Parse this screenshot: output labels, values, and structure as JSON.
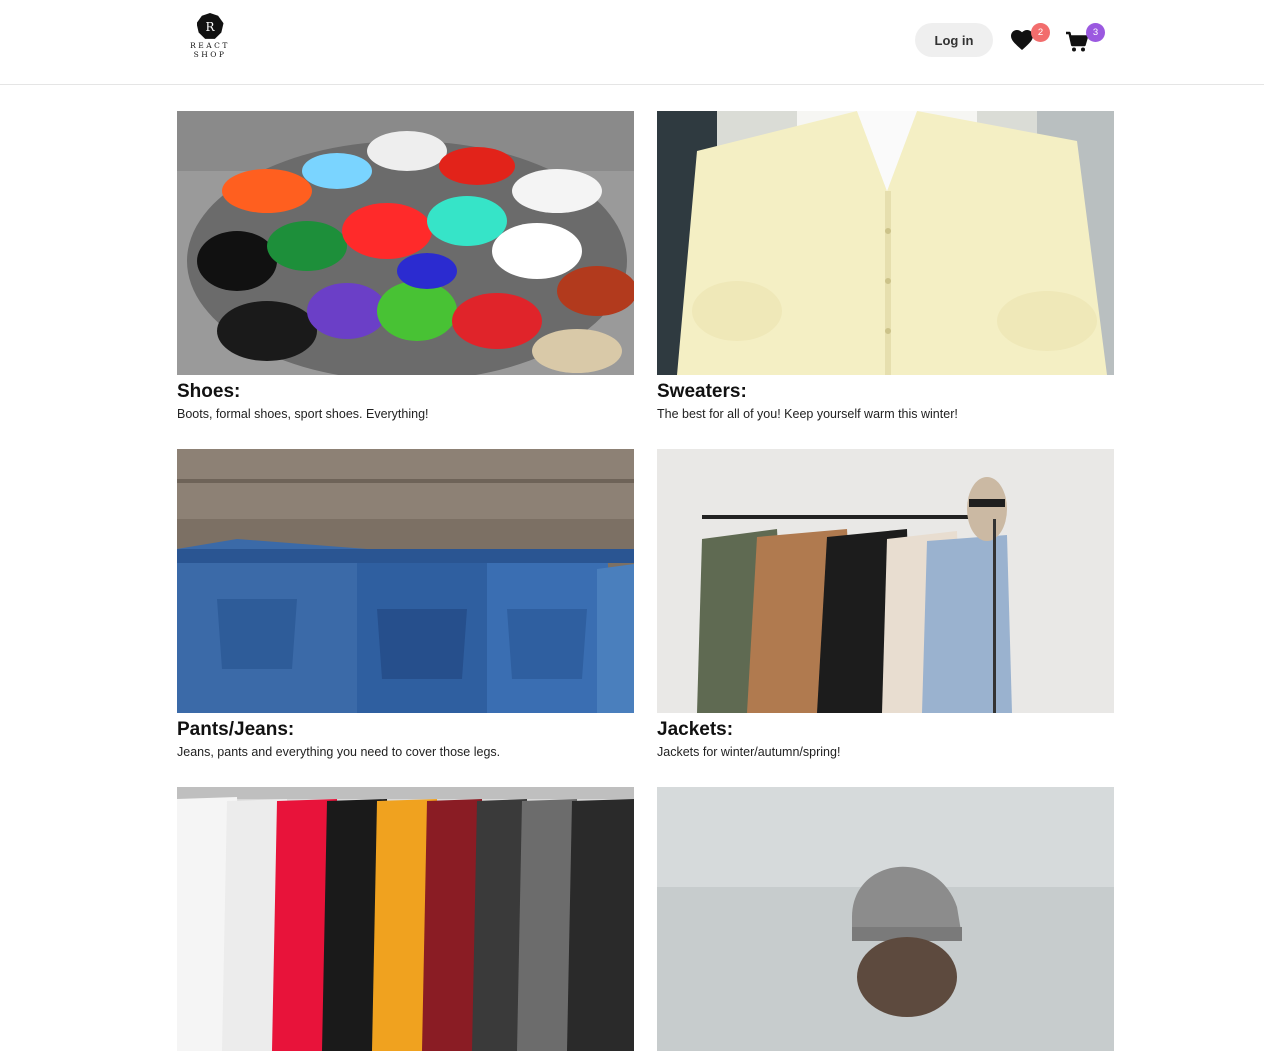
{
  "brand": {
    "line1": "REACT",
    "line2": "SHOP",
    "mark": "R"
  },
  "header": {
    "login_label": "Log in",
    "wishlist_count": "2",
    "cart_count": "3",
    "wishlist_icon": "heart-icon",
    "cart_icon": "cart-icon"
  },
  "categories": [
    {
      "title": "Shoes:",
      "description": "Boots, formal shoes, sport shoes. Everything!"
    },
    {
      "title": "Sweaters:",
      "description": "The best for all of you! Keep yourself warm this winter!"
    },
    {
      "title": "Pants/Jeans:",
      "description": "Jeans, pants and everything you need to cover those legs."
    },
    {
      "title": "Jackets:",
      "description": "Jackets for winter/autumn/spring!"
    },
    {
      "title": "",
      "description": ""
    },
    {
      "title": "",
      "description": ""
    }
  ],
  "colors": {
    "wish_badge": "#f26d6d",
    "cart_badge": "#9b59e0",
    "login_bg": "#efefef"
  }
}
